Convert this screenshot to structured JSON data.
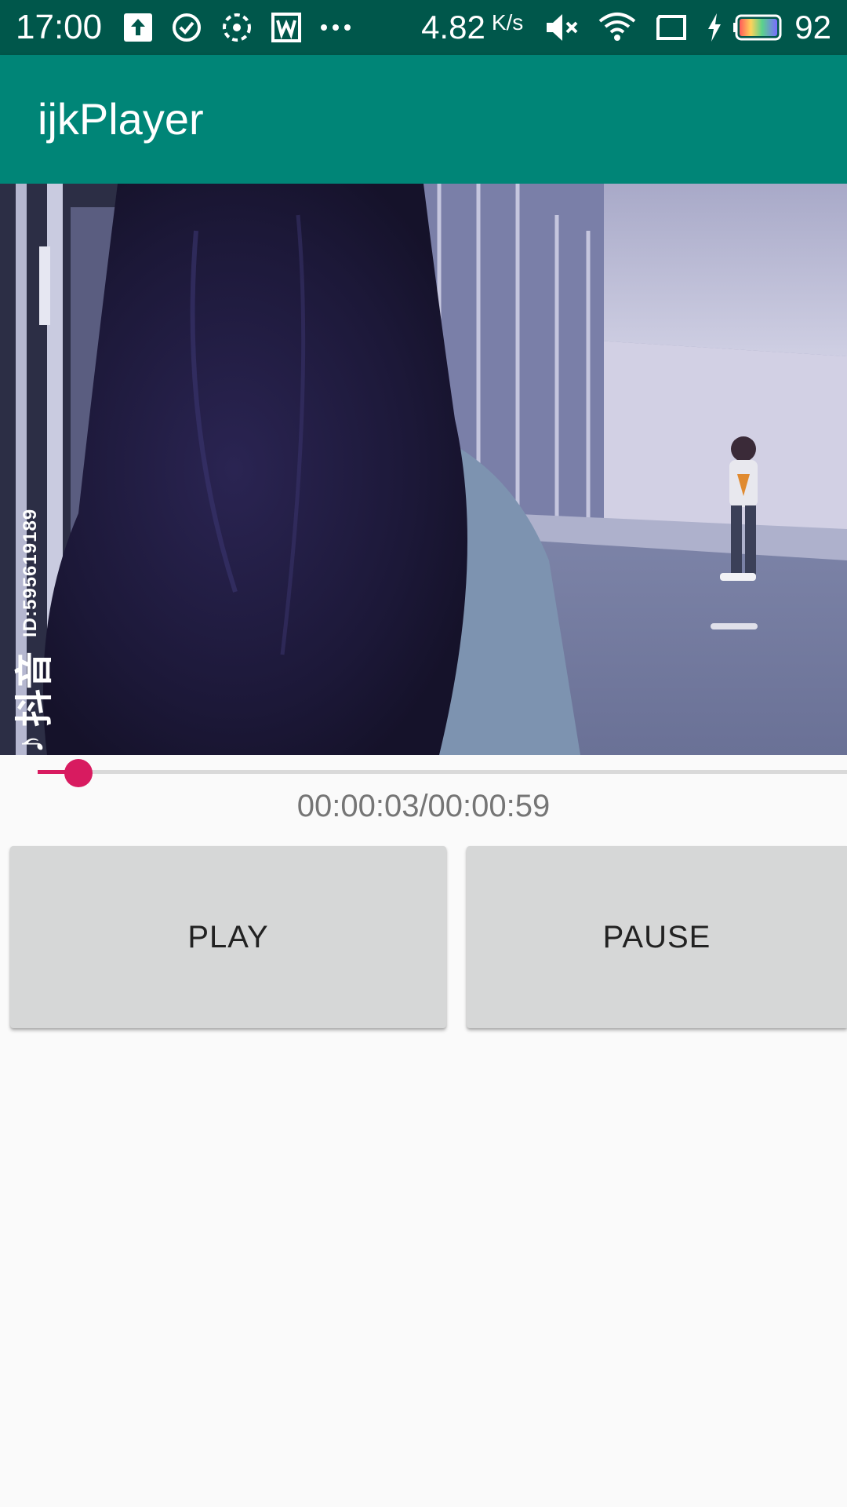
{
  "status_bar": {
    "time": "17:00",
    "left_icons": [
      "upload-icon",
      "check-circle-icon",
      "sync-icon",
      "wps-icon",
      "more-dots-icon"
    ],
    "net_speed": "4.82",
    "net_speed_unit": "K/s",
    "right_icons": [
      "mute-icon",
      "wifi-icon",
      "tablet-icon",
      "charging-icon",
      "battery-icon"
    ],
    "battery_level": "92"
  },
  "app_bar": {
    "title": "ijkPlayer"
  },
  "video": {
    "watermark_logo": "♪",
    "watermark_brand": "抖音",
    "watermark_id": "ID:595619189"
  },
  "seekbar": {
    "progress": 0.0508
  },
  "player": {
    "time_display": "00:00:03/00:00:59"
  },
  "buttons": {
    "play_label": "PLAY",
    "pause_label": "PAUSE"
  },
  "colors": {
    "status_bar": "#00574b",
    "app_bar": "#008577",
    "accent": "#d81b60",
    "button": "#d6d7d7",
    "background": "#fafafa"
  }
}
